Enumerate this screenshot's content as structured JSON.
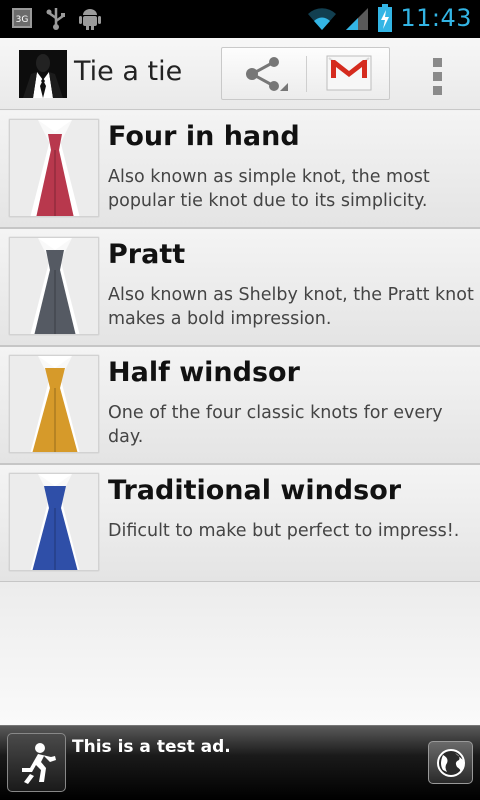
{
  "status_bar": {
    "time": "11:43",
    "icons": [
      "3g-icon",
      "usb-icon",
      "android-debug-icon",
      "wifi-icon",
      "signal-icon",
      "battery-charging-icon"
    ],
    "accent_color": "#33b5e5"
  },
  "action_bar": {
    "title": "Tie a tie",
    "actions": [
      "share-icon",
      "gmail-icon",
      "overflow-menu-icon"
    ]
  },
  "knots": [
    {
      "title": "Four in hand",
      "description": "Also known as simple knot, the most popular tie knot due to its simplicity.",
      "tie_color": "#b8384d"
    },
    {
      "title": "Pratt",
      "description": "Also known as Shelby knot, the Pratt knot makes a bold impression.",
      "tie_color": "#555a63"
    },
    {
      "title": "Half windsor",
      "description": "One of the four classic knots for every day.",
      "tie_color": "#d69a2a"
    },
    {
      "title": "Traditional windsor",
      "description": "Dificult to make but perfect to impress!.",
      "tie_color": "#2f4fa8"
    }
  ],
  "ad": {
    "text": "This is a test ad.",
    "icons": [
      "running-man-icon",
      "globe-icon"
    ]
  }
}
